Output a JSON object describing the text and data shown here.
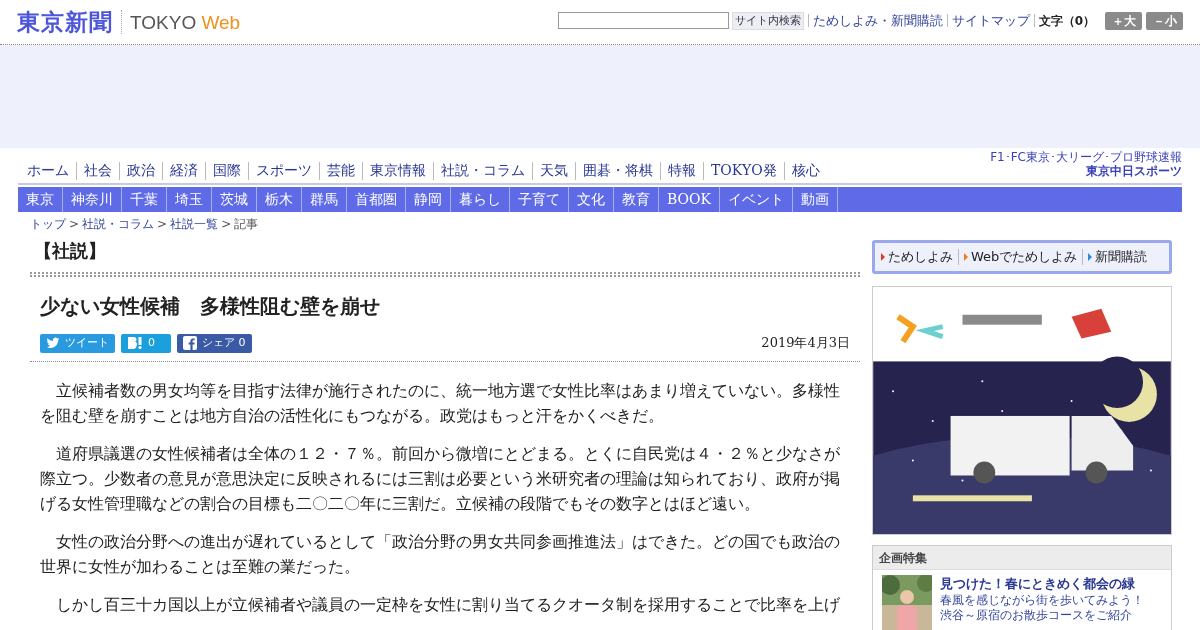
{
  "header": {
    "logo": "東京新聞",
    "brand": "TOKYO",
    "brand_suffix": "Web",
    "search": {
      "button": "サイト内検索"
    },
    "links": [
      "ためしよみ・新聞購読",
      "サイトマップ"
    ],
    "font_size_label": "文字（0）",
    "font_buttons": [
      "＋大",
      "－小"
    ]
  },
  "nav": {
    "items": [
      {
        "label": "ホーム"
      },
      {
        "label": "社会"
      },
      {
        "label": "政治"
      },
      {
        "label": "経済"
      },
      {
        "label": "国際"
      },
      {
        "label": "スポーツ"
      },
      {
        "label": "芸能"
      },
      {
        "label": "東京情報"
      },
      {
        "label": "社説・コラム"
      },
      {
        "label": "天気"
      },
      {
        "label": "囲碁・将棋"
      },
      {
        "label": "特報"
      },
      {
        "label": "TOKYO発"
      },
      {
        "label": "核心"
      }
    ],
    "sports_banner": {
      "caption": "F1･FC東京･大リーグ･プロ野球速報",
      "name": "東京中日スポーツ"
    }
  },
  "subnav": [
    "東京",
    "神奈川",
    "千葉",
    "埼玉",
    "茨城",
    "栃木",
    "群馬",
    "首都圏",
    "静岡",
    "暮らし",
    "子育て",
    "文化",
    "教育",
    "BOOK",
    "イベント",
    "動画"
  ],
  "breadcrumb": {
    "links": [
      "トップ",
      "社説・コラム",
      "社説一覧"
    ],
    "separator": ">",
    "current": "記事"
  },
  "article": {
    "section": "【社説】",
    "title": "少ない女性候補　多様性阻む壁を崩せ",
    "share": [
      {
        "kind": "twitter",
        "label": "ツイート"
      },
      {
        "kind": "hatena",
        "label": "0"
      },
      {
        "kind": "facebook",
        "label": "シェア 0"
      }
    ],
    "date": "2019年4月3日",
    "paragraphs": [
      "立候補者数の男女均等を目指す法律が施行されたのに、統一地方選で女性比率はあまり増えていない。多様性を阻む壁を崩すことは地方自治の活性化にもつながる。政党はもっと汗をかくべきだ。",
      "道府県議選の女性候補者は全体の１２・７％。前回から微増にとどまる。とくに自民党は４・２％と少なさが際立つ。少数者の意見が意思決定に反映されるには三割は必要という米研究者の理論は知られており、政府が掲げる女性管理職などの割合の目標も二〇二〇年に三割だ。立候補の段階でもその数字とはほど遠い。",
      "女性の政治分野への進出が遅れているとして「政治分野の男女共同参画推進法」はできた。どの国でも政治の世界に女性が加わることは至難の業だった。",
      "しかし百三十カ国以上が立候補者や議員の一定枠を女性に割り当てるクオータ制を採用することで比率を上げ"
    ]
  },
  "sidebar": {
    "promo_links": [
      "ためしよみ",
      "Webでためしよみ",
      "新聞購読"
    ],
    "ad": {
      "kind": "picture"
    },
    "feature": {
      "heading": "企画特集",
      "title": "見つけた！春にときめく都会の緑",
      "description": [
        "春風を感じながら街を歩いてみよう！",
        "渋谷～原宿のお散歩コースをご紹介"
      ]
    }
  }
}
